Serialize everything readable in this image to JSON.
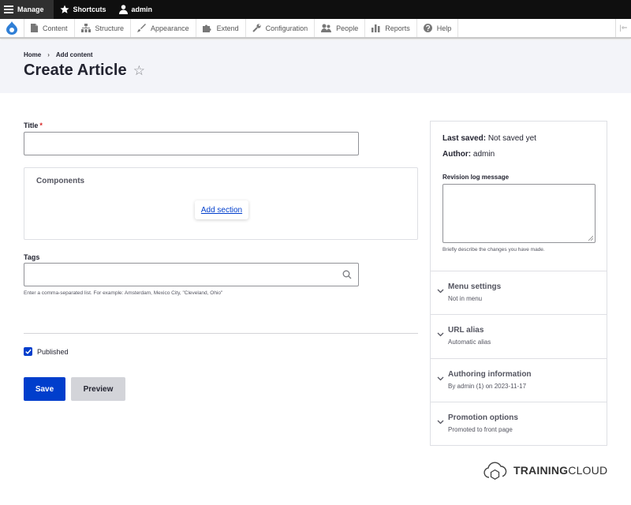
{
  "toolbar": {
    "manage": "Manage",
    "shortcuts": "Shortcuts",
    "user": "admin"
  },
  "admin_menu": {
    "items": [
      "Content",
      "Structure",
      "Appearance",
      "Extend",
      "Configuration",
      "People",
      "Reports",
      "Help"
    ],
    "collapse_glyph": "|⇐"
  },
  "header": {
    "breadcrumb": [
      "Home",
      "Add content"
    ],
    "breadcrumb_sep": "›",
    "title": "Create Article",
    "star_glyph": "☆"
  },
  "form": {
    "title_label": "Title",
    "required_mark": "*",
    "title_value": "",
    "components_title": "Components",
    "add_section": "Add section",
    "tags_label": "Tags",
    "tags_value": "",
    "tags_help": "Enter a comma-separated list. For example: Amsterdam, Mexico City, \"Cleveland, Ohio\"",
    "published_label": "Published",
    "published_checked": true,
    "save": "Save",
    "preview": "Preview"
  },
  "sidebar": {
    "last_saved_label": "Last saved:",
    "last_saved_value": "Not saved yet",
    "author_label": "Author:",
    "author_value": "admin",
    "revision_label": "Revision log message",
    "revision_value": "",
    "revision_help": "Briefly describe the changes you have made.",
    "sections": [
      {
        "title": "Menu settings",
        "summary": "Not in menu"
      },
      {
        "title": "URL alias",
        "summary": "Automatic alias"
      },
      {
        "title": "Authoring information",
        "summary": "By admin (1) on 2023-11-17"
      },
      {
        "title": "Promotion options",
        "summary": "Promoted to front page"
      }
    ]
  },
  "logo": {
    "bold": "TRAINING",
    "regular": "CLOUD"
  },
  "colors": {
    "toolbar_bg": "#0f0f0f",
    "primary": "#003ecc",
    "header_bg": "#f3f4f9",
    "required": "#d72222"
  }
}
